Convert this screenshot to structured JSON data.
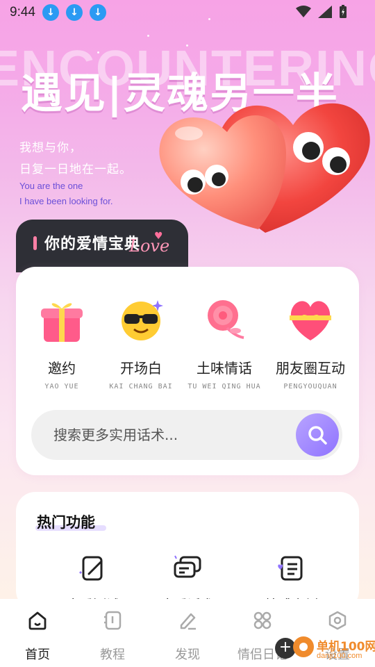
{
  "status_bar": {
    "time": "9:44"
  },
  "hero": {
    "bg_word": "ENCOUNTERING",
    "title": "遇见|灵魂另一半",
    "line1": "我想与你，",
    "line2": "日复一日地在一起。",
    "en1": "You are the one",
    "en2": "I have been looking for."
  },
  "tab": {
    "title": "你的爱情宝典",
    "script": "Love"
  },
  "categories": [
    {
      "label": "邀约",
      "pinyin": "YAO YUE",
      "icon": "gift-icon"
    },
    {
      "label": "开场白",
      "pinyin": "KAI CHANG BAI",
      "icon": "sunglasses-emoji-icon"
    },
    {
      "label": "土味情话",
      "pinyin": "TU WEI QING HUA",
      "icon": "rose-icon"
    },
    {
      "label": "朋友圈互动",
      "pinyin": "PENGYOUQUAN",
      "icon": "heart-gift-icon"
    }
  ],
  "search": {
    "placeholder": "搜索更多实用话术..."
  },
  "hot": {
    "title": "热门功能",
    "items": [
      {
        "label": "恋爱测试",
        "icon": "edit-note-icon"
      },
      {
        "label": "恋爱话术",
        "icon": "chat-bubble-icon"
      },
      {
        "label": "情感案例",
        "icon": "list-document-icon"
      }
    ]
  },
  "nav": [
    {
      "label": "首页",
      "icon": "home-icon",
      "active": true
    },
    {
      "label": "教程",
      "icon": "book-icon",
      "active": false
    },
    {
      "label": "发现",
      "icon": "pen-icon",
      "active": false
    },
    {
      "label": "情侣日记",
      "icon": "grid-icon",
      "active": false
    },
    {
      "label": "设置",
      "icon": "settings-icon",
      "active": false
    }
  ],
  "watermark": {
    "text": "单机100网",
    "url": "danji100.com"
  },
  "colors": {
    "accent": "#8f73ff",
    "tab_bg": "#2e2f36",
    "pink": "#ff6f9b"
  }
}
